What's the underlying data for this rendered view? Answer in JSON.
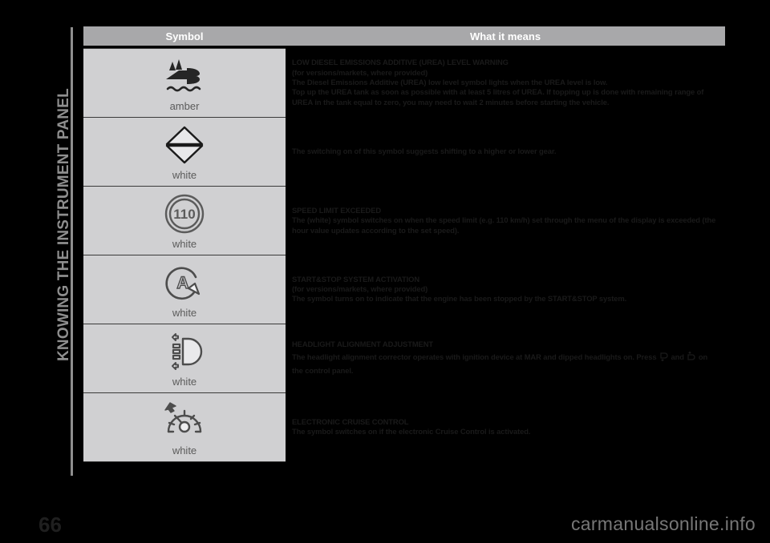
{
  "page": {
    "chapter_title": "KNOWING THE INSTRUMENT PANEL",
    "page_number": "66",
    "watermark": "carmanualsonline.info",
    "background_color": "#000000",
    "header_bg_color": "#a8a8aa",
    "symbol_cell_bg_color": "#d0d0d2"
  },
  "table": {
    "headers": {
      "symbol": "Symbol",
      "meaning": "What it means"
    },
    "rows": [
      {
        "icon_name": "urea-low-level-icon",
        "color_label": "amber",
        "title": "LOW DIESEL EMISSIONS ADDITIVE (UREA) LEVEL WARNING",
        "subtitle": "(for versions/markets, where provided)",
        "body": "The Diesel Emissions Additive (UREA) low level symbol lights when the UREA level is low.",
        "body2": "Top up the UREA tank as soon as possible with at least 5 litres of UREA. If topping up is done with remaining range of UREA in the tank equal to zero, you may need to wait 2 minutes before starting the vehicle."
      },
      {
        "icon_name": "gear-shift-indicator-icon",
        "color_label": "white",
        "title": "",
        "subtitle": "",
        "body": "The switching on of this symbol suggests shifting to a higher or lower gear.",
        "body2": ""
      },
      {
        "icon_name": "speed-limit-exceeded-icon",
        "icon_text": "110",
        "color_label": "white",
        "title": "SPEED LIMIT EXCEEDED",
        "subtitle": "",
        "body": "The (white) symbol switches on when the speed limit (e.g. 110 km/h) set through the menu of the display is exceeded (the hour value updates according to the set speed).",
        "body2": ""
      },
      {
        "icon_name": "start-stop-system-icon",
        "color_label": "white",
        "title": "START&STOP SYSTEM ACTIVATION",
        "subtitle": "(for versions/markets, where provided)",
        "body": "The symbol turns on to indicate that the engine has been stopped by the START&STOP system.",
        "body2": ""
      },
      {
        "icon_name": "headlight-alignment-icon",
        "color_label": "white",
        "title": "HEADLIGHT ALIGNMENT ADJUSTMENT",
        "subtitle": "",
        "body_part1": "The headlight alignment corrector operates with ignition device at MAR and dipped headlights on. Press",
        "body_part2": "and",
        "body_part3": "on the control panel.",
        "body2": ""
      },
      {
        "icon_name": "cruise-control-icon",
        "color_label": "white",
        "title": "ELECTRONIC CRUISE CONTROL",
        "subtitle": "",
        "body": "The symbol switches on if the electronic Cruise Control is activated.",
        "body2": ""
      }
    ]
  }
}
